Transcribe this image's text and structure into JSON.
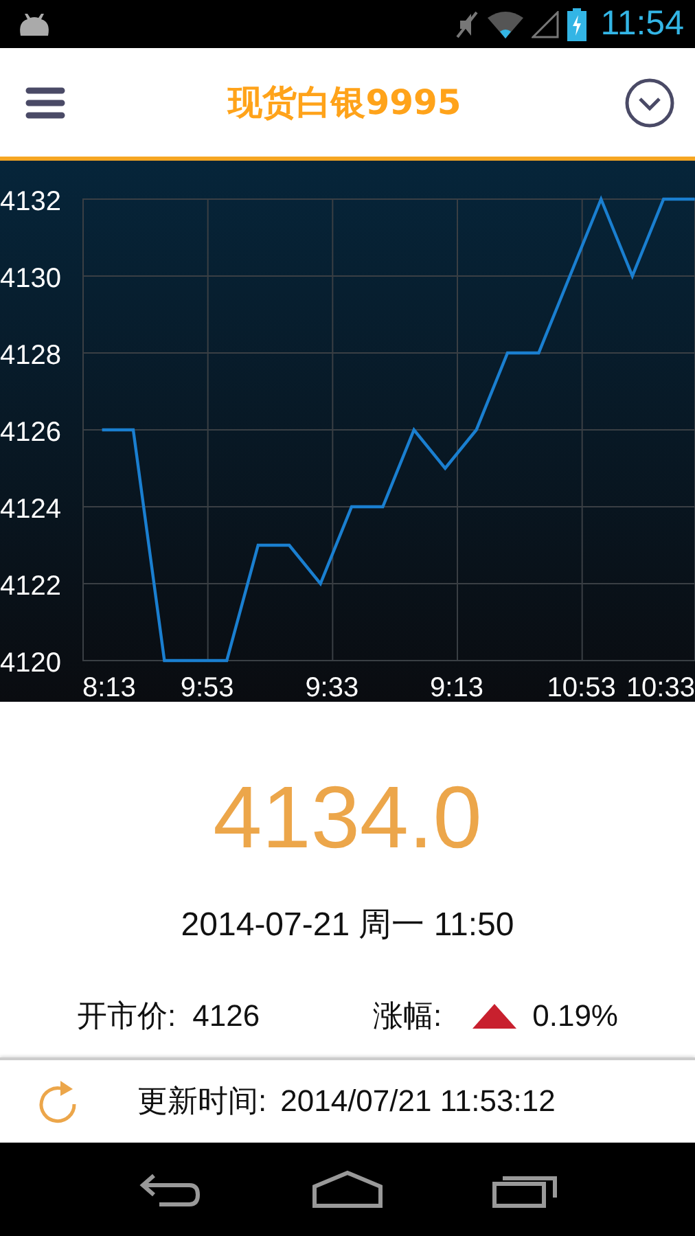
{
  "status_bar": {
    "time": "11:54"
  },
  "header": {
    "title": "现货白银9995"
  },
  "chart": {
    "chart_data": {
      "type": "line",
      "grid": true,
      "categories": [
        "8:13",
        null,
        null,
        "9:53",
        null,
        null,
        null,
        "9:33",
        null,
        null,
        null,
        "9:13",
        null,
        null,
        null,
        "10:53",
        null,
        null,
        "10:33",
        null
      ],
      "series": [
        {
          "color": "#1a7fd0",
          "values": [
            4126,
            4126,
            4120,
            4120,
            4120,
            4123,
            4123,
            4122,
            4124,
            4124,
            4126,
            4125,
            4126,
            4128,
            4128,
            4130,
            4132,
            4130,
            4132,
            4132
          ]
        }
      ],
      "ylim": [
        4120,
        4132
      ],
      "yticks": [
        4120,
        4122,
        4124,
        4126,
        4128,
        4130,
        4132
      ]
    }
  },
  "price": "4134.0",
  "date_line": "2014-07-21 周一 11:50",
  "open_price": {
    "label": "开市价:",
    "value": "4126"
  },
  "change": {
    "label": "涨幅:",
    "kind": "up",
    "value": "0.19%"
  },
  "update": {
    "label": "更新时间:",
    "value": "2014/07/21 11:53:12"
  }
}
